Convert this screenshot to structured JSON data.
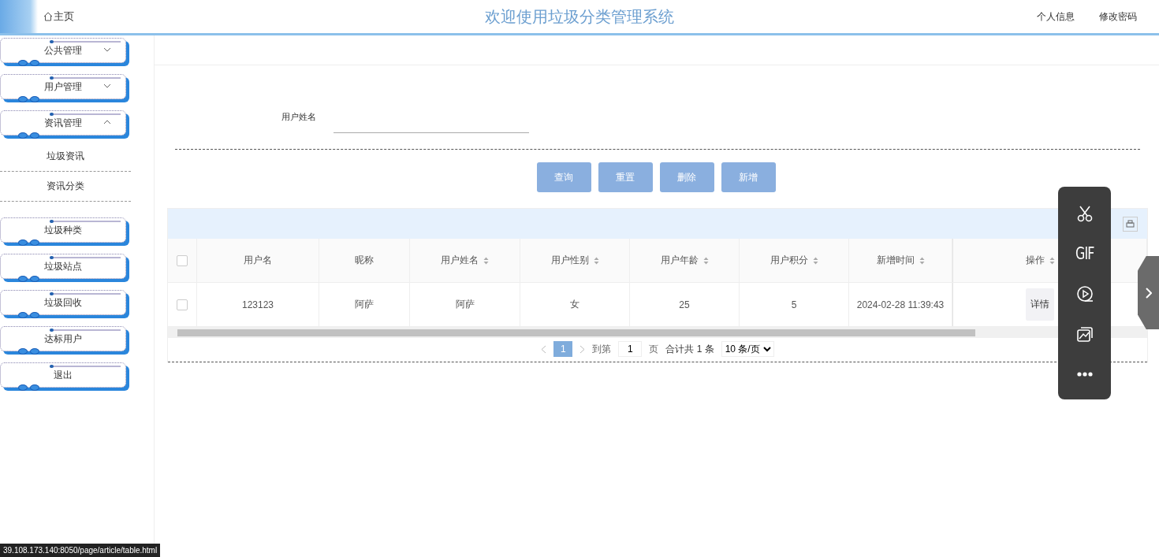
{
  "header": {
    "home_label": "主页",
    "title": "欢迎使用垃圾分类管理系统",
    "links": [
      "个人信息",
      "修改密码"
    ]
  },
  "sidebar": {
    "items": [
      {
        "label": "公共管理",
        "expanded": false
      },
      {
        "label": "用户管理",
        "expanded": false
      },
      {
        "label": "资讯管理",
        "expanded": true,
        "children": [
          {
            "label": "垃圾资讯"
          },
          {
            "label": "资讯分类"
          }
        ]
      },
      {
        "label": "垃圾种类"
      },
      {
        "label": "垃圾站点"
      },
      {
        "label": "垃圾回收"
      },
      {
        "label": "达标用户"
      },
      {
        "label": "退出"
      }
    ]
  },
  "search": {
    "label": "用户姓名"
  },
  "buttons": [
    "查询",
    "重置",
    "删除",
    "新增"
  ],
  "table": {
    "select_all_checked": false,
    "columns": [
      {
        "label": "用户名",
        "sortable": false
      },
      {
        "label": "昵称",
        "sortable": false
      },
      {
        "label": "用户姓名",
        "sortable": true
      },
      {
        "label": "用户性别",
        "sortable": true
      },
      {
        "label": "用户年龄",
        "sortable": true
      },
      {
        "label": "用户积分",
        "sortable": true
      },
      {
        "label": "新增时间",
        "sortable": true
      }
    ],
    "action_column": {
      "label": "操作",
      "sortable": true
    },
    "rows": [
      {
        "checked": false,
        "cells": [
          "123123",
          "阿萨",
          "阿萨",
          "女",
          "25",
          "5",
          "2024-02-28 11:39:43"
        ],
        "action": "详情"
      }
    ]
  },
  "pagination": {
    "pages": [
      {
        "label": "1",
        "selected": true
      }
    ],
    "goto_label": "到第",
    "goto_value": "1",
    "page_unit": "页",
    "total": "合计共 1 条",
    "page_size": "10 条/页"
  },
  "capture_toolbar": {
    "items": [
      {
        "kind": "scissors"
      },
      {
        "kind": "gif",
        "label": "GIF"
      },
      {
        "kind": "record"
      },
      {
        "kind": "screenshot"
      },
      {
        "kind": "more"
      }
    ]
  },
  "status_url": "39.108.173.140:8050/page/article/table.html"
}
